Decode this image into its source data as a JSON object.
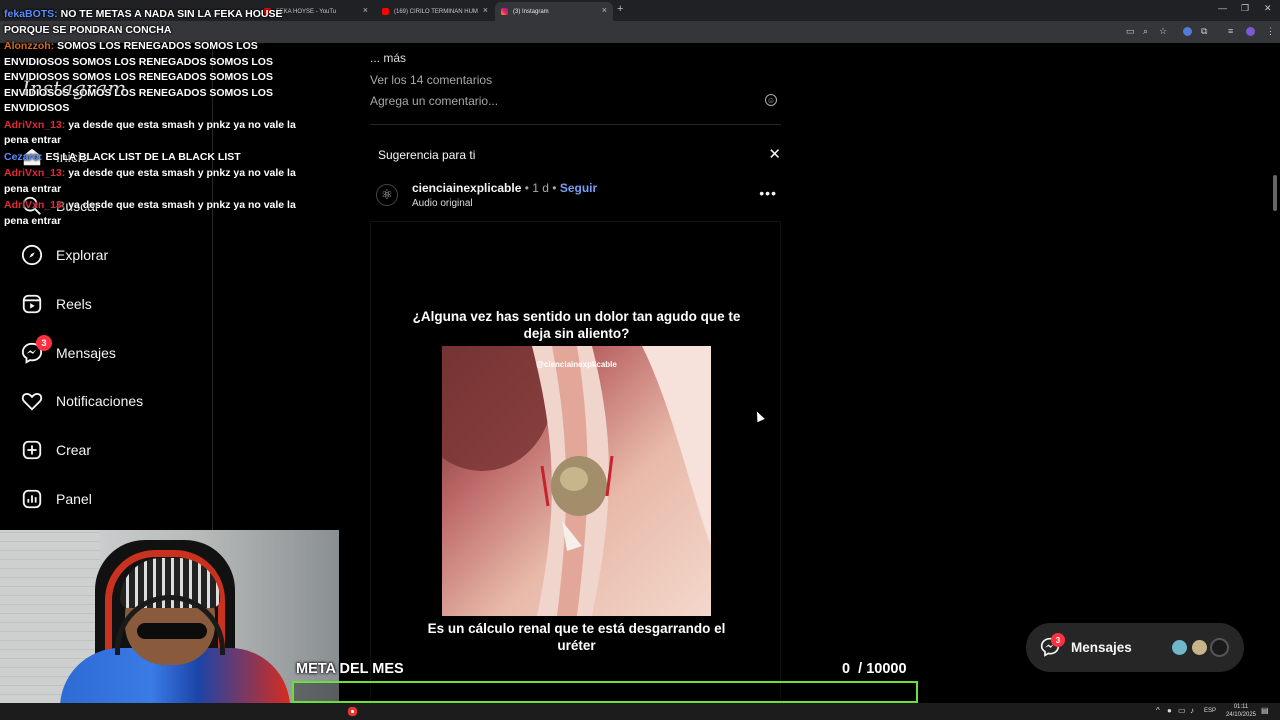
{
  "browser": {
    "tabs": [
      {
        "label": "FEKA HOYSE - YouTu",
        "active": false
      },
      {
        "label": "(169) CIRILO TERMINAN HUM",
        "active": false
      },
      {
        "label": "(3) Instagram",
        "active": true
      }
    ],
    "new_tab": "+",
    "minimize": "—",
    "maximize": "❐",
    "close": "✕"
  },
  "sidebar": {
    "logo": "Instagram",
    "items": [
      {
        "label": "Inicio",
        "icon": "home-icon"
      },
      {
        "label": "Buscar",
        "icon": "search-icon"
      },
      {
        "label": "Explorar",
        "icon": "compass-icon"
      },
      {
        "label": "Reels",
        "icon": "reels-icon"
      },
      {
        "label": "Mensajes",
        "icon": "messenger-icon",
        "badge": "3"
      },
      {
        "label": "Notificaciones",
        "icon": "heart-icon"
      },
      {
        "label": "Crear",
        "icon": "plus-square-icon"
      },
      {
        "label": "Panel",
        "icon": "dashboard-icon"
      }
    ]
  },
  "chat": [
    {
      "user": "fekaBOTS:",
      "text": "NO TE METAS A NADA SIN LA FEKA HOUSE PORQUE SE PONDRAN CONCHA",
      "color": "blue"
    },
    {
      "user": "Alonzzoh:",
      "text": "SOMOS LOS RENEGADOS SOMOS LOS ENVIDIOSOS SOMOS LOS RENEGADOS SOMOS LOS ENVIDIOSOS SOMOS LOS RENEGADOS SOMOS LOS ENVIDIOSOS SOMOS LOS RENEGADOS SOMOS LOS ENVIDIOSOS",
      "color": "orange"
    },
    {
      "user": "AdriVxn_13:",
      "text": "ya desde que esta smash y pnkz ya no vale la pena entrar",
      "color": "red"
    },
    {
      "user": "Cezaro:",
      "text": "ES LA BLACK LIST DE LA BLACK LIST",
      "color": "blue"
    },
    {
      "user": "AdriVxn_13:",
      "text": "ya desde que esta smash y pnkz ya no vale la pena entrar",
      "color": "red"
    },
    {
      "user": "AdriVxn_13:",
      "text": "ya desde que esta smash y pnkz ya no vale la pena entrar",
      "color": "red"
    }
  ],
  "feed": {
    "more": "... más",
    "view_comments": "Ver los 14 comentarios",
    "add_comment_placeholder": "Agrega un comentario...",
    "suggestion_title": "Sugerencia para ti",
    "account": {
      "name": "cienciainexplicable",
      "time": "• 1 d •",
      "follow": "Seguir",
      "audio": "Audio original"
    },
    "video": {
      "question": "¿Alguna vez has sentido un dolor tan agudo que te deja sin aliento?",
      "watermark": "@cienciainexplicable",
      "answer": "Es un cálculo renal que te está desgarrando el uréter"
    }
  },
  "messages_pill": {
    "label": "Mensajes",
    "badge": "3"
  },
  "goal": {
    "title": "META DEL MES",
    "current": "0",
    "target": "/ 10000",
    "progress_fraction": 0
  },
  "taskbar": {
    "lang": "ESP",
    "time": "01:11",
    "date": "24/10/2025"
  },
  "colors": {
    "accent_blue": "#7a9cf5",
    "badge_red": "#ff3040",
    "goal_green": "#6be03a"
  }
}
